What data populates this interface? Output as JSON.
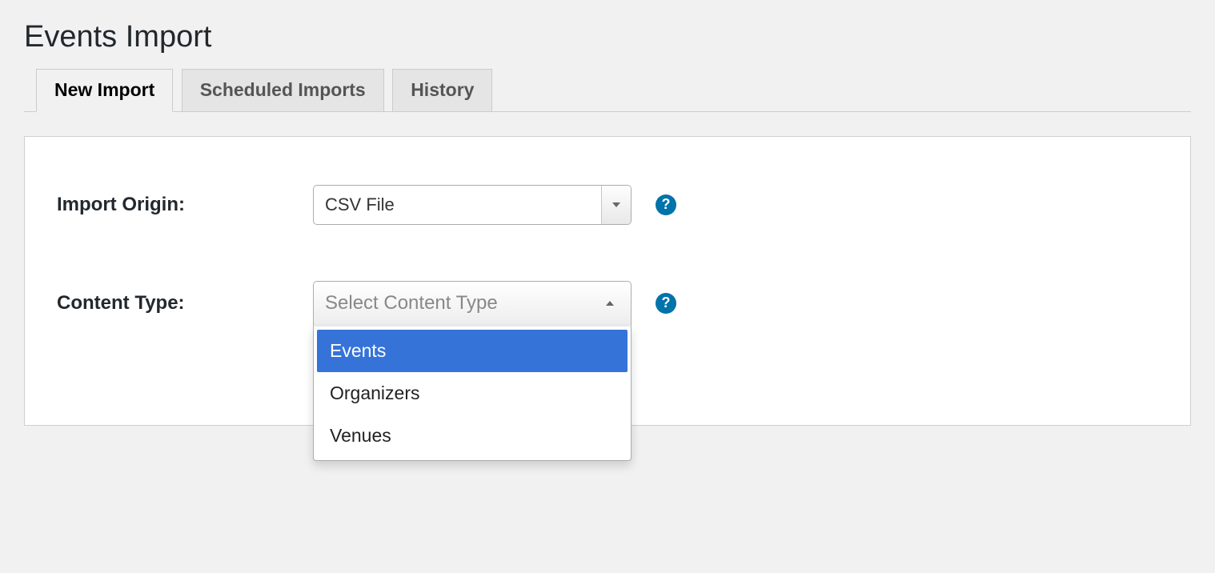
{
  "page": {
    "title": "Events Import"
  },
  "tabs": [
    {
      "label": "New Import",
      "active": true
    },
    {
      "label": "Scheduled Imports",
      "active": false
    },
    {
      "label": "History",
      "active": false
    }
  ],
  "form": {
    "origin": {
      "label": "Import Origin:",
      "value": "CSV File"
    },
    "content_type": {
      "label": "Content Type:",
      "placeholder": "Select Content Type",
      "options": [
        "Events",
        "Organizers",
        "Venues"
      ],
      "highlighted_index": 0
    }
  },
  "help_glyph": "?"
}
